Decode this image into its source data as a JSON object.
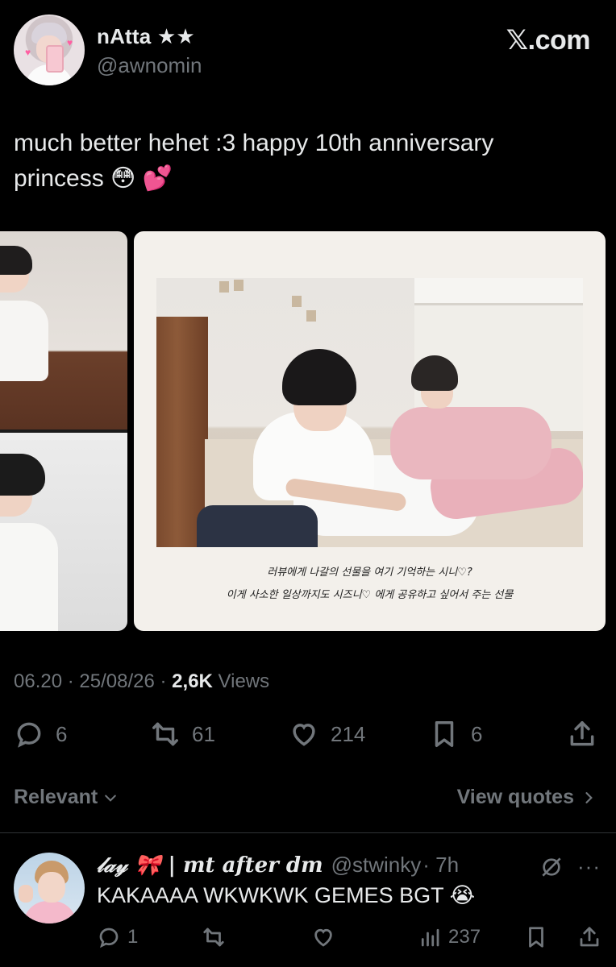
{
  "author": {
    "display_name": "nAtta ★★",
    "handle": "@awnomin"
  },
  "brand": "𝕏.com",
  "tweet": {
    "text_line1": "much better hehet :3 happy 10th anniversary",
    "text_line2": "princess 😳 💕",
    "caption_line1": "러뷰에게 나갈의 선물을 여기 기억하는 시니♡?",
    "caption_line2": "이게 사소한 일상까지도 시즈니♡ 에게 공유하고 싶어서 주는 선물"
  },
  "meta": {
    "time": "06.20",
    "date": "25/08/26",
    "views_count": "2,6K",
    "views_label": "Views",
    "sep": "·"
  },
  "actions": {
    "replies": "6",
    "reposts": "61",
    "likes": "214",
    "bookmarks": "6"
  },
  "sort": {
    "relevant_label": "Relevant",
    "view_quotes_label": "View quotes"
  },
  "reply": {
    "display_name": "𝓁𝒶𝓎 🎀 | mt after dm",
    "handle": "@stwinky",
    "time": "· 7h",
    "text": "KAKAAAA WKWKWK GEMES BGT 😭",
    "replies": "1",
    "views": "237"
  },
  "colors": {
    "background": "#000000",
    "text_primary": "#e7e9ea",
    "text_secondary": "#71767b",
    "divider": "#2f3336"
  }
}
